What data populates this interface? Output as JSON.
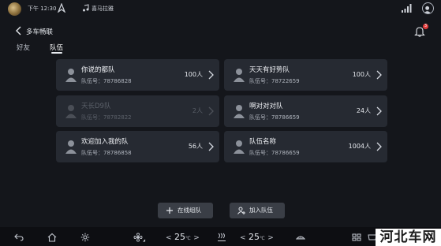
{
  "status_bar": {
    "time": "下午 12:30",
    "now_playing": "喜马拉雅"
  },
  "header": {
    "title": "多车畅联",
    "notification_count": "3"
  },
  "tabs": [
    {
      "label": "好友",
      "active": false
    },
    {
      "label": "队伍",
      "active": true
    }
  ],
  "teams": [
    {
      "name": "你说的都队",
      "id_label": "队伍号：78786828",
      "count": "100人",
      "enabled": true
    },
    {
      "name": "天天有好势队",
      "id_label": "队伍号：78722659",
      "count": "100人",
      "enabled": true
    },
    {
      "name": "天长D9队",
      "id_label": "队伍号：78782822",
      "count": "2人",
      "enabled": false
    },
    {
      "name": "啊对对对队",
      "id_label": "队伍号：78786659",
      "count": "24人",
      "enabled": true
    },
    {
      "name": "欢迎加入我的队",
      "id_label": "队伍号：78786858",
      "count": "56人",
      "enabled": true
    },
    {
      "name": "队伍名称",
      "id_label": "队伍号：78786659",
      "count": "1004人",
      "enabled": true
    }
  ],
  "actions": {
    "create_online_team": "在线组队",
    "join_team": "加入队伍"
  },
  "dock": {
    "left_temp": "25",
    "right_temp": "25",
    "temp_unit": "℃"
  },
  "watermark": "河北车网",
  "colors": {
    "background": "#14161b",
    "card": "#262a32",
    "button": "#3a3e46",
    "badge": "#e23b3b"
  },
  "icons": [
    "avatar-logo-icon",
    "navigation-arrow-icon",
    "music-icon",
    "signal-icon",
    "user-avatar-icon",
    "back-icon",
    "bell-icon",
    "person-icon",
    "chevron-right-icon",
    "plus-icon",
    "add-person-icon",
    "return-icon",
    "home-icon",
    "settings-icon",
    "fan-icon",
    "defrost-icon",
    "seat-heat-icon",
    "grid-icon",
    "windshield-icon"
  ]
}
